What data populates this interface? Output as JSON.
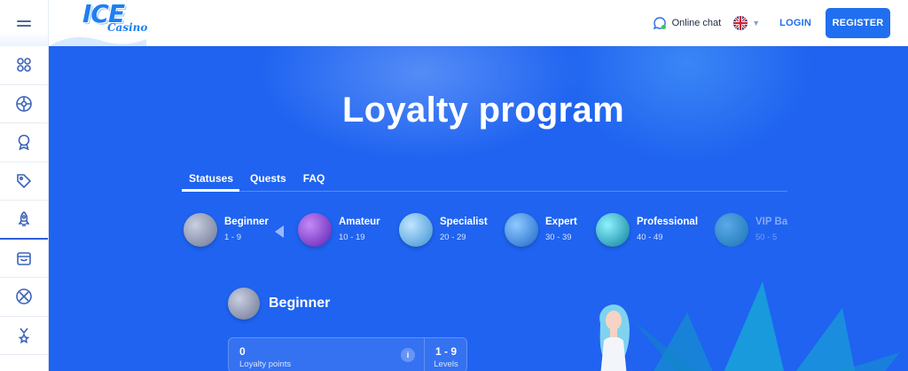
{
  "header": {
    "logo_main": "ICE",
    "logo_sub": "Casino",
    "online_chat": "Online chat",
    "login": "LOGIN",
    "register": "REGISTER"
  },
  "sidebar": {
    "items": [
      {
        "icon": "grid-icon"
      },
      {
        "icon": "ball-icon"
      },
      {
        "icon": "award-icon"
      },
      {
        "icon": "tag-icon"
      },
      {
        "icon": "rocket-icon",
        "active": true
      },
      {
        "icon": "bag-icon"
      },
      {
        "icon": "sport-icon"
      },
      {
        "icon": "medal-icon"
      }
    ]
  },
  "hero": {
    "title": "Loyalty program",
    "tabs": [
      {
        "label": "Statuses",
        "active": true
      },
      {
        "label": "Quests"
      },
      {
        "label": "FAQ"
      }
    ],
    "levels": [
      {
        "name": "Beginner",
        "range": "1 - 9",
        "color": "#8c96b4"
      },
      {
        "name": "Amateur",
        "range": "10 - 19",
        "color": "#8a3fd8"
      },
      {
        "name": "Specialist",
        "range": "20 - 29",
        "color": "#5fb1e8"
      },
      {
        "name": "Expert",
        "range": "30 - 39",
        "color": "#2f8fe0"
      },
      {
        "name": "Professional",
        "range": "40 - 49",
        "color": "#17b3c6"
      },
      {
        "name": "VIP Ba",
        "range": "50 - 5",
        "color": "#2fc09a"
      }
    ],
    "current_status": "Beginner",
    "stats": {
      "points_value": "0",
      "points_label": "Loyalty points",
      "info": "i",
      "levels_value": "1 - 9",
      "levels_label": "Levels"
    }
  },
  "colors": {
    "brand_blue": "#1f6ff0",
    "hero_bg": "#1f63f0"
  }
}
